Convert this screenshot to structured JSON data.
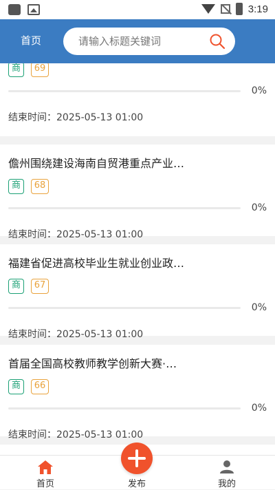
{
  "status_bar": {
    "time": "3:19"
  },
  "header": {
    "home_label": "首页",
    "search_placeholder": "请输入标题关键词"
  },
  "cards": [
    {
      "title": "",
      "type_tag": "商",
      "number_tag": "69",
      "progress": 0,
      "progress_label": "0%",
      "end_time": "结束时间：2025-05-13 01:00"
    },
    {
      "title": "儋州围绕建设海南自贸港重点产业…",
      "type_tag": "商",
      "number_tag": "68",
      "progress": 0,
      "progress_label": "0%",
      "end_time": "结束时间：2025-05-13 01:00"
    },
    {
      "title": "福建省促进高校毕业生就业创业政…",
      "type_tag": "商",
      "number_tag": "67",
      "progress": 0,
      "progress_label": "0%",
      "end_time": "结束时间：2025-05-13 01:00"
    },
    {
      "title": "首届全国高校教师教学创新大赛·…",
      "type_tag": "商",
      "number_tag": "66",
      "progress": 0,
      "progress_label": "0%",
      "end_time": "结束时间：2025-05-13 01:00"
    }
  ],
  "bottom_nav": {
    "home": "首页",
    "publish": "发布",
    "mine": "我的"
  },
  "colors": {
    "accent": "#3b7cc2",
    "publish": "#f0522c",
    "type_tag": "#1aa074",
    "number_tag": "#e9a23b"
  }
}
